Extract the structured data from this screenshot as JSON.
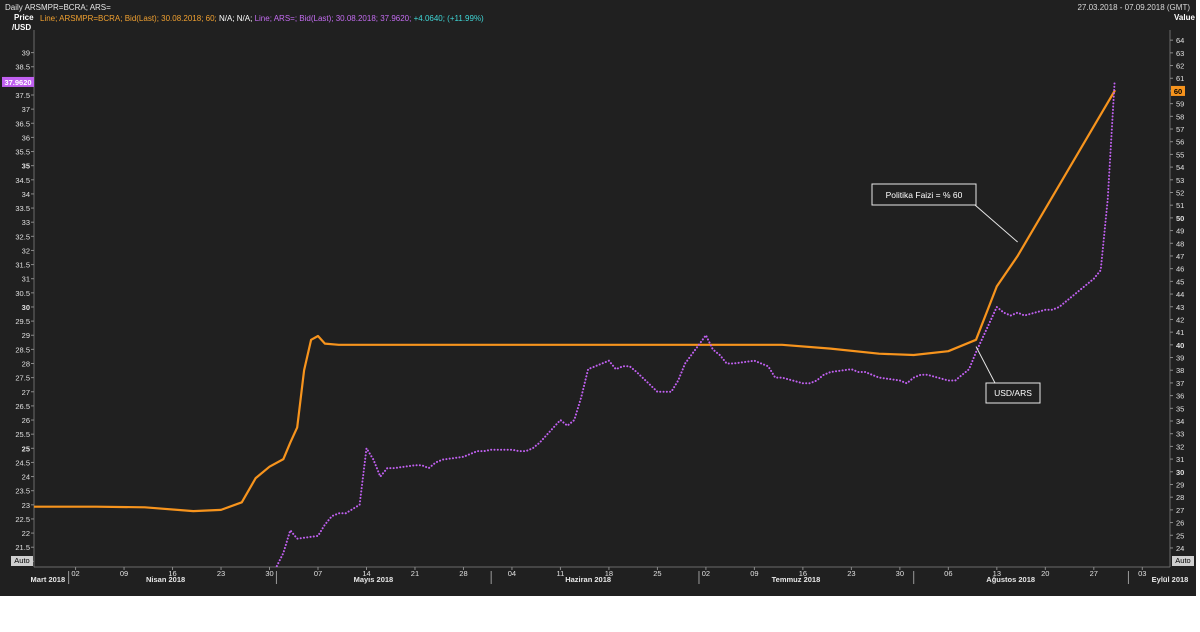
{
  "header": {
    "title": "Daily ARSMPR=BCRA; ARS=",
    "date_range": "27.03.2018 - 07.09.2018 (GMT)",
    "legend": {
      "s1": "Line; ARSMPR=BCRA; Bid(Last); 30.08.2018; 60;",
      "s1_na": "N/A; N/A;",
      "s2": "Line; ARS=; Bid(Last); 30.08.2018; 37.9620;",
      "s2_change": "+4.0640; (+11.99%)"
    },
    "left_axis_label_1": "Price",
    "left_axis_label_2": "/USD",
    "right_axis_label": "Value",
    "auto_left": "Auto",
    "auto_right": "Auto"
  },
  "colors": {
    "background": "#202020",
    "policy_rate": "#f7941d",
    "usd_ars": "#c060f0",
    "text": "#e0e0e0",
    "annotation_box": "#202020"
  },
  "chart_data": {
    "type": "line",
    "x_axis": {
      "day_ticks": [
        {
          "d": "2018-04-02",
          "label": "02"
        },
        {
          "d": "2018-04-09",
          "label": "09"
        },
        {
          "d": "2018-04-16",
          "label": "16"
        },
        {
          "d": "2018-04-23",
          "label": "23"
        },
        {
          "d": "2018-04-30",
          "label": "30"
        },
        {
          "d": "2018-05-07",
          "label": "07"
        },
        {
          "d": "2018-05-14",
          "label": "14"
        },
        {
          "d": "2018-05-21",
          "label": "21"
        },
        {
          "d": "2018-05-28",
          "label": "28"
        },
        {
          "d": "2018-06-04",
          "label": "04"
        },
        {
          "d": "2018-06-11",
          "label": "11"
        },
        {
          "d": "2018-06-18",
          "label": "18"
        },
        {
          "d": "2018-06-25",
          "label": "25"
        },
        {
          "d": "2018-07-02",
          "label": "02"
        },
        {
          "d": "2018-07-09",
          "label": "09"
        },
        {
          "d": "2018-07-16",
          "label": "16"
        },
        {
          "d": "2018-07-23",
          "label": "23"
        },
        {
          "d": "2018-07-30",
          "label": "30"
        },
        {
          "d": "2018-08-06",
          "label": "06"
        },
        {
          "d": "2018-08-13",
          "label": "13"
        },
        {
          "d": "2018-08-20",
          "label": "20"
        },
        {
          "d": "2018-08-27",
          "label": "27"
        },
        {
          "d": "2018-09-03",
          "label": "03"
        }
      ],
      "month_labels": [
        {
          "d": "2018-03-29",
          "label": "Mart 2018"
        },
        {
          "d": "2018-04-15",
          "label": "Nisan 2018"
        },
        {
          "d": "2018-05-15",
          "label": "Mayıs 2018"
        },
        {
          "d": "2018-06-15",
          "label": "Haziran 2018"
        },
        {
          "d": "2018-07-15",
          "label": "Temmuz 2018"
        },
        {
          "d": "2018-08-15",
          "label": "Ağustos 2018"
        },
        {
          "d": "2018-09-07",
          "label": "Eylül 2018"
        }
      ],
      "month_boundaries": [
        "2018-04-01",
        "2018-05-01",
        "2018-06-01",
        "2018-07-01",
        "2018-08-01",
        "2018-09-01"
      ]
    },
    "left_axis": {
      "unit": "USD/ARS",
      "ylim": [
        20.8,
        39.8
      ],
      "ticks": [
        21,
        21.5,
        22,
        22.5,
        23,
        23.5,
        24,
        24.5,
        25,
        25.5,
        26,
        26.5,
        27,
        27.5,
        28,
        28.5,
        29,
        29.5,
        30,
        30.5,
        31,
        31.5,
        32,
        32.5,
        33,
        33.5,
        34,
        34.5,
        35,
        35.5,
        36,
        36.5,
        37,
        37.5,
        38,
        38.5,
        39
      ],
      "tick_labels": [
        "21",
        "21.5",
        "22",
        "22.5",
        "23",
        "23.5",
        "24",
        "24.5",
        "25",
        "25.5",
        "26",
        "26.5",
        "27",
        "27.5",
        "28",
        "28.5",
        "29",
        "29.5",
        "30",
        "30.5",
        "31",
        "31.5",
        "32",
        "32.5",
        "33",
        "33.5",
        "34",
        "34.5",
        "35",
        "35.5",
        "36",
        "36.5",
        "37",
        "37.5",
        "38",
        "38.5",
        "39"
      ],
      "bold": [
        "25",
        "30",
        "35"
      ],
      "last_value_tag": "37.9620",
      "last_value": 37.962
    },
    "right_axis": {
      "unit": "Value",
      "ylim": [
        22.5,
        64.8
      ],
      "ticks": [
        24,
        25,
        26,
        27,
        28,
        29,
        30,
        31,
        32,
        33,
        34,
        35,
        36,
        37,
        38,
        39,
        40,
        41,
        42,
        43,
        44,
        45,
        46,
        47,
        48,
        49,
        50,
        51,
        52,
        53,
        54,
        55,
        56,
        57,
        58,
        59,
        60,
        61,
        62,
        63,
        64
      ],
      "tick_labels": [
        "24",
        "25",
        "26",
        "27",
        "28",
        "29",
        "30",
        "31",
        "32",
        "33",
        "34",
        "35",
        "36",
        "37",
        "38",
        "39",
        "40",
        "41",
        "42",
        "43",
        "44",
        "45",
        "46",
        "47",
        "48",
        "49",
        "50",
        "51",
        "52",
        "53",
        "54",
        "55",
        "56",
        "57",
        "58",
        "59",
        "60",
        "61",
        "62",
        "63",
        "64"
      ],
      "bold": [
        "30",
        "40",
        "50",
        "60"
      ],
      "last_value_tag": "60",
      "last_value": 60
    },
    "series": [
      {
        "name": "Politika Faizi",
        "axis": "right",
        "points": [
          [
            "2018-03-27",
            27.25
          ],
          [
            "2018-04-05",
            27.25
          ],
          [
            "2018-04-12",
            27.2
          ],
          [
            "2018-04-19",
            26.9
          ],
          [
            "2018-04-23",
            27.0
          ],
          [
            "2018-04-26",
            27.6
          ],
          [
            "2018-04-28",
            29.5
          ],
          [
            "2018-04-30",
            30.4
          ],
          [
            "2018-05-02",
            31.0
          ],
          [
            "2018-05-03",
            32.3
          ],
          [
            "2018-05-04",
            33.5
          ],
          [
            "2018-05-05",
            38.0
          ],
          [
            "2018-05-06",
            40.4
          ],
          [
            "2018-05-07",
            40.7
          ],
          [
            "2018-05-08",
            40.1
          ],
          [
            "2018-05-10",
            40.0
          ],
          [
            "2018-07-13",
            40.0
          ],
          [
            "2018-07-20",
            39.7
          ],
          [
            "2018-07-27",
            39.3
          ],
          [
            "2018-08-01",
            39.2
          ],
          [
            "2018-08-06",
            39.5
          ],
          [
            "2018-08-10",
            40.4
          ],
          [
            "2018-08-13",
            44.6
          ],
          [
            "2018-08-16",
            47.0
          ],
          [
            "2018-08-30",
            60.0
          ]
        ]
      },
      {
        "name": "USD/ARS",
        "axis": "left",
        "points": [
          [
            "2018-04-30",
            20.6
          ],
          [
            "2018-05-01",
            20.8
          ],
          [
            "2018-05-02",
            21.3
          ],
          [
            "2018-05-03",
            22.1
          ],
          [
            "2018-05-04",
            21.8
          ],
          [
            "2018-05-07",
            21.9
          ],
          [
            "2018-05-08",
            22.3
          ],
          [
            "2018-05-09",
            22.6
          ],
          [
            "2018-05-10",
            22.7
          ],
          [
            "2018-05-11",
            22.7
          ],
          [
            "2018-05-13",
            23.0
          ],
          [
            "2018-05-14",
            25.0
          ],
          [
            "2018-05-15",
            24.6
          ],
          [
            "2018-05-16",
            24.0
          ],
          [
            "2018-05-17",
            24.3
          ],
          [
            "2018-05-18",
            24.3
          ],
          [
            "2018-05-21",
            24.4
          ],
          [
            "2018-05-22",
            24.4
          ],
          [
            "2018-05-23",
            24.3
          ],
          [
            "2018-05-24",
            24.5
          ],
          [
            "2018-05-25",
            24.6
          ],
          [
            "2018-05-28",
            24.7
          ],
          [
            "2018-05-29",
            24.8
          ],
          [
            "2018-05-30",
            24.9
          ],
          [
            "2018-05-31",
            24.9
          ],
          [
            "2018-06-01",
            24.95
          ],
          [
            "2018-06-04",
            24.95
          ],
          [
            "2018-06-05",
            24.9
          ],
          [
            "2018-06-06",
            24.9
          ],
          [
            "2018-06-07",
            25.0
          ],
          [
            "2018-06-08",
            25.2
          ],
          [
            "2018-06-11",
            26.0
          ],
          [
            "2018-06-12",
            25.8
          ],
          [
            "2018-06-13",
            26.0
          ],
          [
            "2018-06-14",
            26.8
          ],
          [
            "2018-06-15",
            27.8
          ],
          [
            "2018-06-18",
            28.1
          ],
          [
            "2018-06-19",
            27.8
          ],
          [
            "2018-06-20",
            27.9
          ],
          [
            "2018-06-21",
            27.9
          ],
          [
            "2018-06-22",
            27.7
          ],
          [
            "2018-06-25",
            27.0
          ],
          [
            "2018-06-26",
            27.0
          ],
          [
            "2018-06-27",
            27.0
          ],
          [
            "2018-06-28",
            27.4
          ],
          [
            "2018-06-29",
            28.0
          ],
          [
            "2018-07-02",
            29.0
          ],
          [
            "2018-07-03",
            28.5
          ],
          [
            "2018-07-04",
            28.3
          ],
          [
            "2018-07-05",
            28.0
          ],
          [
            "2018-07-06",
            28.0
          ],
          [
            "2018-07-09",
            28.1
          ],
          [
            "2018-07-10",
            28.0
          ],
          [
            "2018-07-11",
            27.9
          ],
          [
            "2018-07-12",
            27.5
          ],
          [
            "2018-07-13",
            27.5
          ],
          [
            "2018-07-16",
            27.3
          ],
          [
            "2018-07-17",
            27.3
          ],
          [
            "2018-07-18",
            27.4
          ],
          [
            "2018-07-19",
            27.6
          ],
          [
            "2018-07-20",
            27.7
          ],
          [
            "2018-07-23",
            27.8
          ],
          [
            "2018-07-24",
            27.7
          ],
          [
            "2018-07-25",
            27.7
          ],
          [
            "2018-07-26",
            27.6
          ],
          [
            "2018-07-27",
            27.5
          ],
          [
            "2018-07-30",
            27.4
          ],
          [
            "2018-07-31",
            27.3
          ],
          [
            "2018-08-01",
            27.5
          ],
          [
            "2018-08-02",
            27.6
          ],
          [
            "2018-08-03",
            27.6
          ],
          [
            "2018-08-06",
            27.4
          ],
          [
            "2018-08-07",
            27.4
          ],
          [
            "2018-08-08",
            27.6
          ],
          [
            "2018-08-09",
            27.8
          ],
          [
            "2018-08-10",
            28.4
          ],
          [
            "2018-08-13",
            30.0
          ],
          [
            "2018-08-14",
            29.8
          ],
          [
            "2018-08-15",
            29.7
          ],
          [
            "2018-08-16",
            29.8
          ],
          [
            "2018-08-17",
            29.7
          ],
          [
            "2018-08-20",
            29.9
          ],
          [
            "2018-08-21",
            29.9
          ],
          [
            "2018-08-22",
            30.0
          ],
          [
            "2018-08-23",
            30.2
          ],
          [
            "2018-08-24",
            30.4
          ],
          [
            "2018-08-27",
            31.0
          ],
          [
            "2018-08-28",
            31.3
          ],
          [
            "2018-08-29",
            33.8
          ],
          [
            "2018-08-30",
            37.962
          ]
        ]
      }
    ],
    "annotations": [
      {
        "text": "Politika Faizi = % 60",
        "target_date": "2018-08-16",
        "target_axis": "right",
        "target_value": 48.1
      },
      {
        "text": "USD/ARS",
        "target_date": "2018-08-10",
        "target_axis": "left",
        "target_value": 28.6
      }
    ]
  }
}
